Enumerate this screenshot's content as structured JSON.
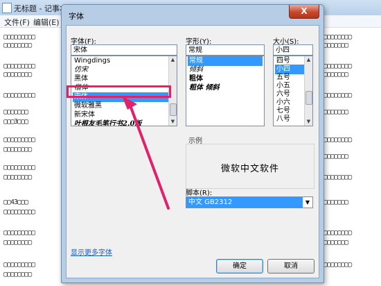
{
  "notepad": {
    "title": "无标题 - 记事本",
    "menu": [
      "文件(F)",
      "编辑(E)"
    ]
  },
  "dialog": {
    "title": "字体",
    "close_label": "X",
    "font": {
      "label": "字体(F):",
      "value": "宋体",
      "items": [
        "Wingdings",
        "仿宋",
        "黑体",
        "楷体",
        "宋体",
        "微软雅黑",
        "新宋体",
        "叶根友毛笔行书2.0版"
      ],
      "selected": "宋体"
    },
    "style": {
      "label": "字形(Y):",
      "value": "常规",
      "items": [
        "常规",
        "倾斜",
        "粗体",
        "粗体 倾斜"
      ],
      "selected": "常规"
    },
    "size": {
      "label": "大小(S):",
      "value": "小四",
      "items": [
        "四号",
        "小四",
        "五号",
        "小五",
        "六号",
        "小六",
        "七号",
        "八号"
      ],
      "selected": "小四"
    },
    "sample": {
      "label": "示例",
      "text": "微软中文软件"
    },
    "script": {
      "label": "脚本(R):",
      "value": "中文 GB2312"
    },
    "more_fonts_link": "显示更多字体",
    "ok_label": "确定",
    "cancel_label": "取消"
  },
  "colors": {
    "highlight": "#e0226a",
    "selection": "#3399ff",
    "dialog_frame": "#b7cde6"
  }
}
